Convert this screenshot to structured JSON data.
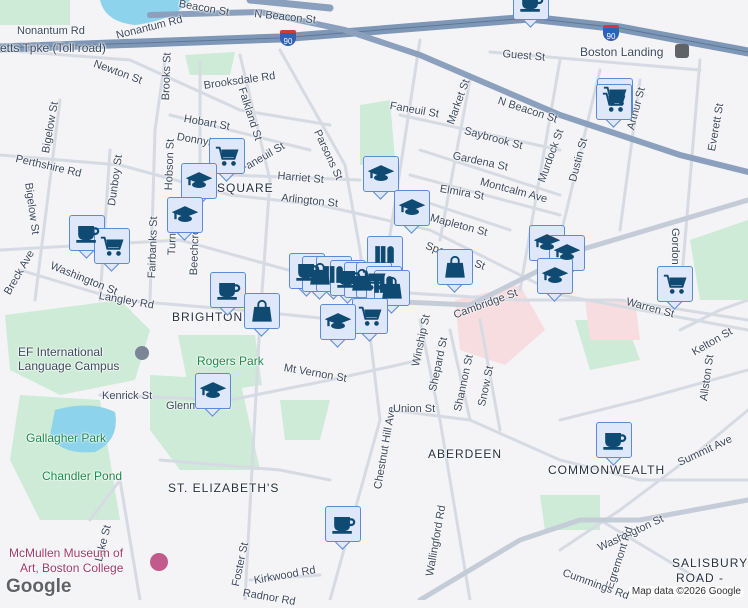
{
  "map": {
    "streets": [
      "Nonantum Rd",
      "Nonantum Rd",
      "Beacon St",
      "N Beacon St",
      "etts Tpke (Toll road)",
      "Newton St",
      "Brooks St",
      "Brooksdale Rd",
      "Hobart St",
      "Falkland St",
      "Donnybrook",
      "Faneuil St",
      "Parsons St",
      "Harriet St",
      "Arlington St",
      "Perthshire Rd",
      "Dunboy St",
      "Bigelow St",
      "Bigelow St",
      "Hobson St",
      "Fairbanks St",
      "Turner St",
      "Beechcroft St",
      "Washington St",
      "Breck Ave",
      "Langley Rd",
      "Mt Vernon St",
      "Kenrick St",
      "Glenmont Rd",
      "Lake St",
      "Foster St",
      "Kirkwood Rd",
      "Radnor Rd",
      "Chestnut Hill Ave",
      "Union St",
      "Winship St",
      "Shepard St",
      "Shannon St",
      "Snow St",
      "Wallingford Rd",
      "Washington St",
      "Summit Ave",
      "Allston St",
      "Kelton St",
      "Warren St",
      "Cambridge St",
      "Sparhawk St",
      "Mapleton St",
      "Elmira St",
      "Montcalm Ave",
      "Gardena St",
      "Saybrook St",
      "Market St",
      "Faneuil St",
      "N Beacon St",
      "Guest St",
      "Murdock St",
      "Dustin St",
      "Arthur St",
      "Everett St",
      "Gordon St",
      "Egremont Rd",
      "Cummings Rd"
    ],
    "neighborhoods": [
      "SQUARE",
      "BRIGHTON",
      "ST. ELIZABETH'S",
      "ABERDEEN",
      "COMMONWEALTH",
      "SALISBURY",
      "ROAD -"
    ],
    "parks": [
      "Rogers Park",
      "Gallagher Park",
      "Chandler Pond"
    ],
    "pois": [
      "EF International",
      "Language Campus",
      "McMullen Museum of",
      "Art, Boston College",
      "Boston Landing"
    ],
    "highway_shield": "90",
    "attribution": "Map data ©2026 Google",
    "logo": "Google"
  },
  "markers": [
    {
      "type": "coffee"
    },
    {
      "type": "cart"
    },
    {
      "type": "cart"
    },
    {
      "type": "cart"
    },
    {
      "type": "grad"
    },
    {
      "type": "grad"
    },
    {
      "type": "coffee"
    },
    {
      "type": "cart"
    },
    {
      "type": "grad"
    },
    {
      "type": "grad"
    },
    {
      "type": "library"
    },
    {
      "type": "coffee"
    },
    {
      "type": "bag"
    },
    {
      "type": "library"
    },
    {
      "type": "coffee"
    },
    {
      "type": "bag"
    },
    {
      "type": "cart"
    },
    {
      "type": "library"
    },
    {
      "type": "bag"
    },
    {
      "type": "bag"
    },
    {
      "type": "grad"
    },
    {
      "type": "grad"
    },
    {
      "type": "grad"
    },
    {
      "type": "cart"
    },
    {
      "type": "coffee"
    },
    {
      "type": "bag"
    },
    {
      "type": "cart"
    },
    {
      "type": "grad"
    },
    {
      "type": "grad"
    },
    {
      "type": "coffee"
    },
    {
      "type": "coffee"
    }
  ],
  "colors": {
    "marker_fill": "#dfe8fb",
    "marker_border": "#5b8ad6",
    "icon": "#0f4a72",
    "highway": "#7f97b6",
    "park": "#cdebd6",
    "water": "#8dd3ec"
  }
}
